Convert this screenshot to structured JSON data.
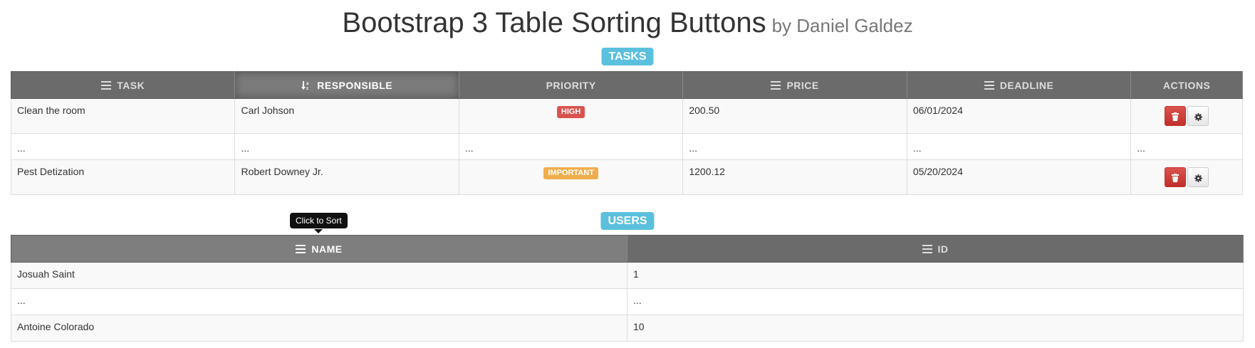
{
  "header": {
    "title": "Bootstrap 3 Table Sorting Buttons",
    "byline": "by Daniel Galdez"
  },
  "tasks": {
    "label": "TASKS",
    "columns": {
      "task": "TASK",
      "responsible": "RESPONSIBLE",
      "priority": "PRIORITY",
      "price": "PRICE",
      "deadline": "DEADLINE",
      "actions": "ACTIONS"
    },
    "rows": [
      {
        "task": "Clean the room",
        "responsible": "Carl Johson",
        "priority": "HIGH",
        "priority_color": "#d9534f",
        "price": "200.50",
        "deadline": "06/01/2024"
      },
      {
        "task": "...",
        "responsible": "...",
        "priority": "...",
        "price": "...",
        "deadline": "...",
        "actions": "..."
      },
      {
        "task": "Pest Detization",
        "responsible": "Robert Downey Jr.",
        "priority": "IMPORTANT",
        "priority_color": "#f0ad4e",
        "price": "1200.12",
        "deadline": "05/20/2024"
      }
    ]
  },
  "users": {
    "label": "USERS",
    "tooltip": "Click to Sort",
    "columns": {
      "name": "NAME",
      "id": "ID"
    },
    "rows": [
      {
        "name": "Josuah Saint",
        "id": "1"
      },
      {
        "name": "...",
        "id": "..."
      },
      {
        "name": "Antoine Colorado",
        "id": "10"
      }
    ]
  },
  "icons": {
    "sort_unsorted": "bars-icon",
    "sort_alpha": "sort-alpha-icon",
    "delete": "trash-icon",
    "settings": "gear-icon"
  },
  "colors": {
    "label_bg": "#5bc0de",
    "header_bg": "#6b6b6b",
    "danger": "#d9534f",
    "warning": "#f0ad4e"
  }
}
